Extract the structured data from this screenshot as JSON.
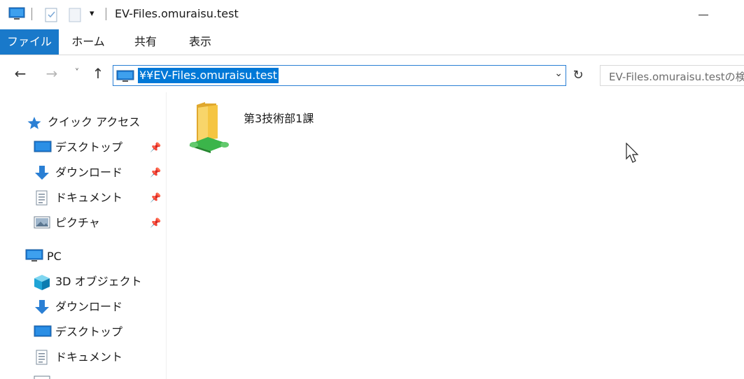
{
  "window": {
    "title": "EV-Files.omuraisu.test"
  },
  "ribbon": {
    "tabs": [
      "ファイル",
      "ホーム",
      "共有",
      "表示"
    ]
  },
  "address": {
    "path": "¥¥EV-Files.omuraisu.test",
    "search_placeholder": "EV-Files.omuraisu.testの検"
  },
  "nav": {
    "quick_access_label": "クイック アクセス",
    "quick_access_items": [
      {
        "label": "デスクトップ",
        "icon": "desktop-icon"
      },
      {
        "label": "ダウンロード",
        "icon": "download-icon"
      },
      {
        "label": "ドキュメント",
        "icon": "document-icon"
      },
      {
        "label": "ピクチャ",
        "icon": "picture-icon"
      }
    ],
    "pc_label": "PC",
    "pc_items": [
      {
        "label": "3D オブジェクト",
        "icon": "3d-objects-icon"
      },
      {
        "label": "ダウンロード",
        "icon": "download-icon"
      },
      {
        "label": "デスクトップ",
        "icon": "desktop-icon"
      },
      {
        "label": "ドキュメント",
        "icon": "document-icon"
      }
    ]
  },
  "content": {
    "items": [
      {
        "name": "第3技術部1課",
        "icon": "network-share-folder-icon"
      }
    ]
  },
  "colors": {
    "accent": "#0078d7",
    "file_tab": "#1979ca",
    "folder": "#f5c542",
    "network_pipe": "#3bb54a"
  }
}
